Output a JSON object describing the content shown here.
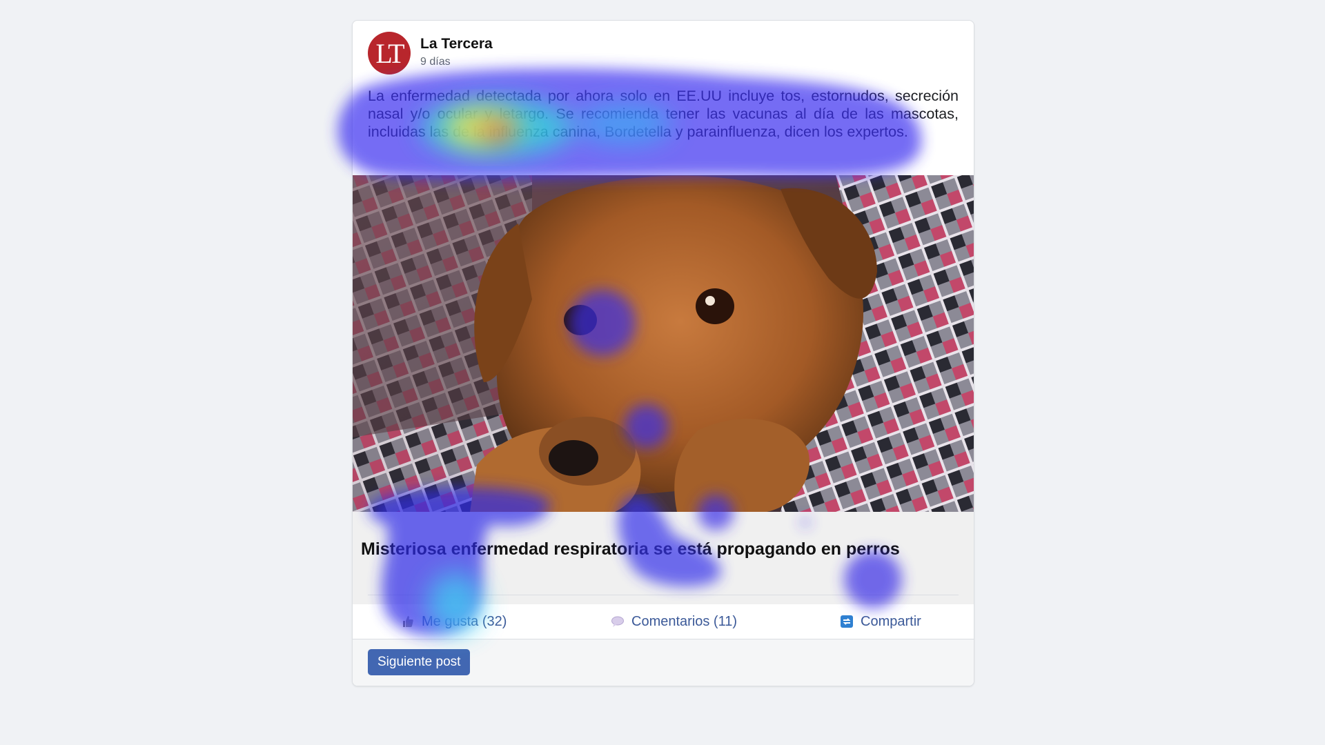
{
  "post": {
    "source": {
      "name": "La Tercera",
      "time": "9 días",
      "avatar_text": "LT",
      "avatar_color": "#b8262c"
    },
    "body": "La enfermedad detectada por ahora solo en EE.UU incluye tos, estornudos, secreción nasal y/o ocular y letargo. Se recomienda tener las vacunas al día de las mascotas, incluidas las de la influenza canina, Bordetella y parainfluenza, dicen los expertos.",
    "image": {
      "subject": "dog-photo"
    },
    "headline": "Misteriosa enfermedad respiratoria se está propagando en perros",
    "actions": {
      "like": "Me gusta (32)",
      "comments": "Comentarios (11)",
      "share": "Compartir"
    }
  },
  "footer": {
    "next_label": "Siguiente post"
  },
  "colors": {
    "link": "#3b5998",
    "button": "#4267b2",
    "page_bg": "#f0f2f5"
  }
}
